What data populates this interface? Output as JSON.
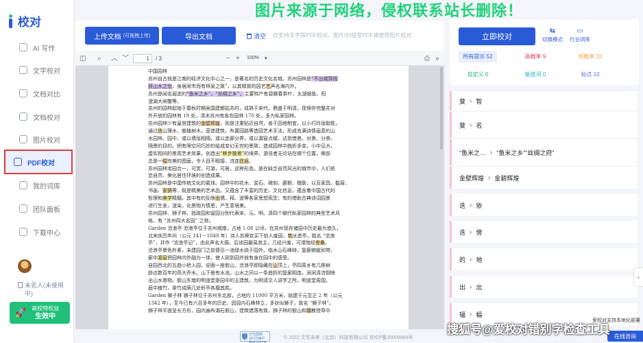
{
  "watermark_top": "图片来源于网络，侵权联系站长删除！",
  "watermark_bottom": "搜狐号@爱校对错别字检查工具",
  "app": {
    "logo_text": "校对"
  },
  "sidebar": {
    "items": [
      {
        "label": "AI 写作",
        "icon": "pen-icon"
      },
      {
        "label": "文字校对",
        "icon": "text-check-icon"
      },
      {
        "label": "文档对比",
        "icon": "compare-icon"
      },
      {
        "label": "文档校对",
        "icon": "document-icon"
      },
      {
        "label": "图片校对",
        "icon": "image-icon"
      },
      {
        "label": "PDF校对",
        "icon": "pdf-icon"
      },
      {
        "label": "我的词库",
        "icon": "book-icon"
      },
      {
        "label": "团队面板",
        "icon": "team-icon"
      },
      {
        "label": "下载中心",
        "icon": "download-icon"
      }
    ],
    "active": "PDF校对",
    "user_status": "未名人(未使用中)",
    "vip": {
      "line1": "高校特权益",
      "line2": "生效中"
    }
  },
  "toolbar": {
    "upload_label": "上传文档",
    "upload_sub": "(可拖拽上传)",
    "export_label": "导出文档",
    "clear_label": "清空",
    "hint": "仅支持文字版PDF校对，图片/扫描型PDF请使用图片校对"
  },
  "pdf_toolbar": {
    "page_current": "1",
    "page_total": "/ 3",
    "zoom": "100%"
  },
  "pdf_lines": [
    [
      [
        "中国园林",
        ""
      ]
    ],
    [
      [
        "苏州自古就是江南的经济文化中心之一，是著名的历史文化名城，苏州园林是",
        ""
      ],
      [
        "“不出城郭而",
        "hl-p"
      ]
    ],
    [
      [
        "获山水之怡",
        "hl-p"
      ],
      [
        "，身居闹市而有林泉之致”，以其精致的园艺",
        ""
      ],
      [
        "艺",
        "hl-o"
      ],
      [
        "声名海内外。",
        ""
      ]
    ],
    [
      [
        "苏州是闻名遐迩的",
        ""
      ],
      [
        "“鱼米之乡”，“丝绸之乡”，",
        "hl-p"
      ],
      [
        "主要特产有碧螺春茶叶、太湖银鱼、阳",
        ""
      ]
    ],
    [
      [
        "澄湖大闸蟹等。",
        ""
      ]
    ],
    [
      [
        "苏州的园林起始于春秋时期吴国建都姑苏时，成熟于宋代，鼎盛于明清。现保存完整并对",
        ""
      ]
    ],
    [
      [
        "外开放的园林有 19 处，清末苏州有各色园林 170 处，多为私家园林。",
        ""
      ]
    ],
    [
      [
        "苏州园林少有皇宫建筑的",
        ""
      ],
      [
        "金壁辉煌",
        "hl-o"
      ],
      [
        "，则是注重贴近自然，善于因地制宜，以小巧玲珑取胜，",
        ""
      ]
    ],
    [
      [
        "通过",
        ""
      ],
      [
        "迭",
        "hl-o"
      ],
      [
        "山理水，栽植树木，营造建筑，布置园路等造园艺术手法，形成充满诗情画意的山",
        ""
      ]
    ],
    [
      [
        "水园林。园中，或以墙垣相隔，或以走廊分界，或以漏窗点缀，达到借景、对景、分景、",
        ""
      ]
    ],
    [
      [
        "隔景的目的。把有限空间巧妙的组成变幻无穷的景致，造成园林中曲折多变，小中见大，",
        ""
      ]
    ],
    [
      [
        "虚实相间的景观艺术效果，创造出",
        ""
      ],
      [
        "“移步换景”",
        "hl-y"
      ],
      [
        "的境界。游览者无论站在哪个位置，眼前",
        ""
      ]
    ],
    [
      [
        "总是一",
        ""
      ],
      [
        "幅",
        "hl-o"
      ],
      [
        "完美的图画，令人目不暇接、流连",
        ""
      ],
      [
        "往返",
        "hl-o"
      ],
      [
        "。",
        ""
      ]
    ],
    [
      [
        "苏州园林宅园合一，可赏，可游，可居，这种形态，是在缺乏自然风光的城市中，人们依",
        ""
      ]
    ],
    [
      [
        "恋自然、美化居住环境的创造成果。",
        ""
      ]
    ],
    [
      [
        "苏州园林是中国传统文化的载体。园林中的花木、盆石、碑刻、匾额、楹联，以及家具、槛窗、",
        ""
      ]
    ],
    [
      [
        "书画、",
        ""
      ],
      [
        "家俱",
        "hl-o"
      ],
      [
        "等，既是精美的艺术品，又蕴含了丰富的历史、文化信息，蕴含着中国古代的",
        ""
      ]
    ],
    [
      [
        "哲理和",
        ""
      ],
      [
        "美学",
        "hl-y"
      ],
      [
        "精髓。其中有的反映",
        ""
      ],
      [
        "出",
        "hl-o"
      ],
      [
        "儒、释、道等各家思想观念；有的借助古典诗词园景",
        ""
      ]
    ],
    [
      [
        "进行生发，渲染，化景物为情思，产生意境美。",
        ""
      ]
    ],
    [
      [
        "苏州园林、狮子林、拙政园和留园分别代表宋、元、明、清四个朝代私家园林的典型艺术风",
        ""
      ]
    ],
    [
      [
        "格，有 “苏州四大名园” 之称。",
        ""
      ]
    ],
    [
      [
        "Garden 沧浪亭 沧浪亭位于苏州城南，占地 1.08 公顷，在苏州现存诸园中历史最为悠久，",
        ""
      ]
    ],
    [
      [
        "北宋庆历年间（公元 141－1048 年）诗人苏舜钦买下前人废园，",
        ""
      ],
      [
        "筑",
        "hl-o"
      ],
      [
        "水造亭，题名 “沧浪",
        ""
      ]
    ],
    [
      [
        "亭”，并作 “沧浪亭记”，由此声名大振。后该园屡易其主，几经兴废，可谓饱经",
        ""
      ],
      [
        "苍桑",
        "hl-o"
      ],
      [
        "。",
        ""
      ]
    ],
    [
      [
        "沧浪亭景色朴素，未建园门之前便见一池绿水绕于园外。临水山石峰峙，复廊蜿蜒如带，",
        ""
      ]
    ],
    [
      [
        "廊中",
        ""
      ],
      [
        "漏窗",
        "hl-y"
      ],
      [
        "把园林内外融为一体，使人刚到园外就有身在园中的感受。",
        ""
      ]
    ],
    [
      [
        "自园西北的五曲小桥入园，迎面一座假山，沧浪亭即隐藏在",
        ""
      ],
      [
        "山",
        "hl-o"
      ],
      [
        "顶上，亭四周乡有几株树",
        ""
      ]
    ],
    [
      [
        "龄达数百年的高大乔木。山下凿有水池，山水之间以一条曲折的复廊相连。涧涧清流倒映",
        ""
      ]
    ],
    [
      [
        "出山水景物。假山东南的明道堂是园中的主建筑，为明清文人讲学之所。明道堂周围，",
        ""
      ]
    ],
    [
      [
        "庭中植竹，翠竹成荫几处轩亭各擅其胜。",
        ""
      ]
    ],
    [
      [
        "Garden 狮子林 狮子林位于苏州东北部，占地约 11000 平方米，始建于元至正 2 年（公元",
        ""
      ]
    ],
    [
      [
        "1342 年），至今已有六百多年的历史。因园内石峰林立，多状似狮子，故名 “狮子林”。",
        ""
      ]
    ],
    [
      [
        "狮子林平面呈长方形，园内遍布湖石假山，建筑错落有致，狮子林的假山和",
        ""
      ],
      [
        "镇",
        "hl-o"
      ],
      [
        "教授章中",
        ""
      ]
    ]
  ],
  "right_panel": {
    "check_label": "立即校对",
    "mode_label": "切换模式",
    "lexicon_label": "行业词库",
    "tags": [
      {
        "label": "所有提示 52",
        "color": "#2a5bd7",
        "active": true
      },
      {
        "label": "高概率 9",
        "color": "#e0455f",
        "active": false
      },
      {
        "label": "低概率 33",
        "color": "#f0a24a",
        "active": false
      },
      {
        "label": "自定义 0",
        "color": "#21b56f",
        "active": false
      },
      {
        "label": "敏感词 0",
        "color": "#2ab4c6",
        "active": false
      },
      {
        "label": "标点 10",
        "color": "#5a6ae0",
        "active": false
      }
    ],
    "results": [
      {
        "from": "斐",
        "to": "智"
      },
      {
        "from": "斐",
        "to": "名"
      },
      {
        "from": "“鱼米之…",
        "to": "“鱼米之乡”“丝绸之府”"
      },
      {
        "from": "金壁辉煌",
        "to": "金碧辉煌"
      },
      {
        "from": "迭",
        "to": "依"
      },
      {
        "from": "迭",
        "to": "傍"
      },
      {
        "from": "的",
        "to": "地"
      },
      {
        "from": "出",
        "to": "出"
      },
      {
        "from": "辐",
        "to": "幅"
      }
    ],
    "support_tip": "爱校对支持本地化部署",
    "online_label": "在线咨询"
  },
  "footer": {
    "badge": "已为您的147万用户服务2023天",
    "copyright": "© 2022 文写未来（北京）科技有限公司 京ICP备20009884号"
  }
}
